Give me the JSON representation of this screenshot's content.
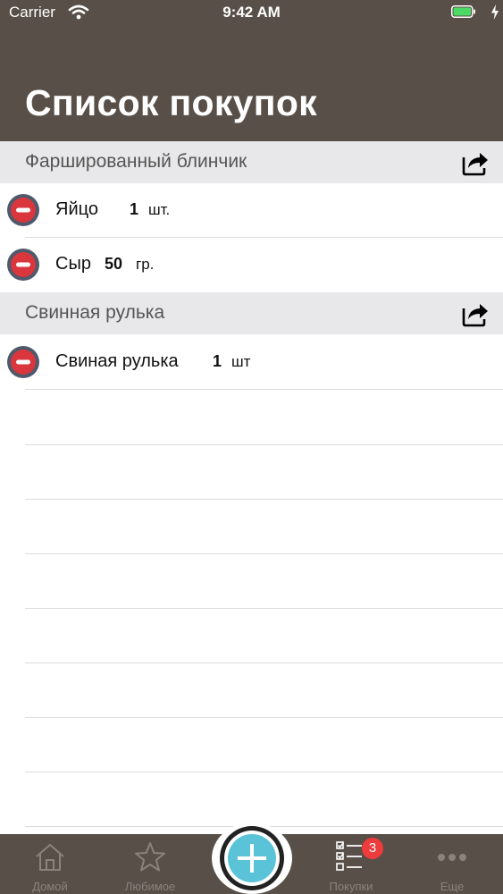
{
  "status_bar": {
    "carrier": "Carrier",
    "time": "9:42 AM"
  },
  "header": {
    "title": "Список покупок"
  },
  "sections": [
    {
      "title": "Фаршированный блинчик",
      "items": [
        {
          "name": "Яйцо",
          "qty": "1",
          "unit": "шт."
        },
        {
          "name": "Сыр",
          "qty": "50",
          "unit": "гр."
        }
      ]
    },
    {
      "title": "Свинная рулька",
      "items": [
        {
          "name": "Свиная рулька",
          "qty": "1",
          "unit": "шт"
        }
      ]
    }
  ],
  "tab_bar": {
    "tabs": [
      {
        "label": "Домой",
        "icon": "home-icon"
      },
      {
        "label": "Любимое",
        "icon": "star-icon"
      },
      {
        "label": "",
        "icon": "add-icon"
      },
      {
        "label": "Покупки",
        "icon": "checklist-icon",
        "badge": "3",
        "active": true
      },
      {
        "label": "Еще",
        "icon": "more-icon"
      }
    ]
  },
  "colors": {
    "header_bg": "#574f48",
    "section_bg": "#e8e7e9",
    "accent": "#5bc3d8",
    "badge": "#ee3b3b",
    "delete": "#d9363e"
  }
}
